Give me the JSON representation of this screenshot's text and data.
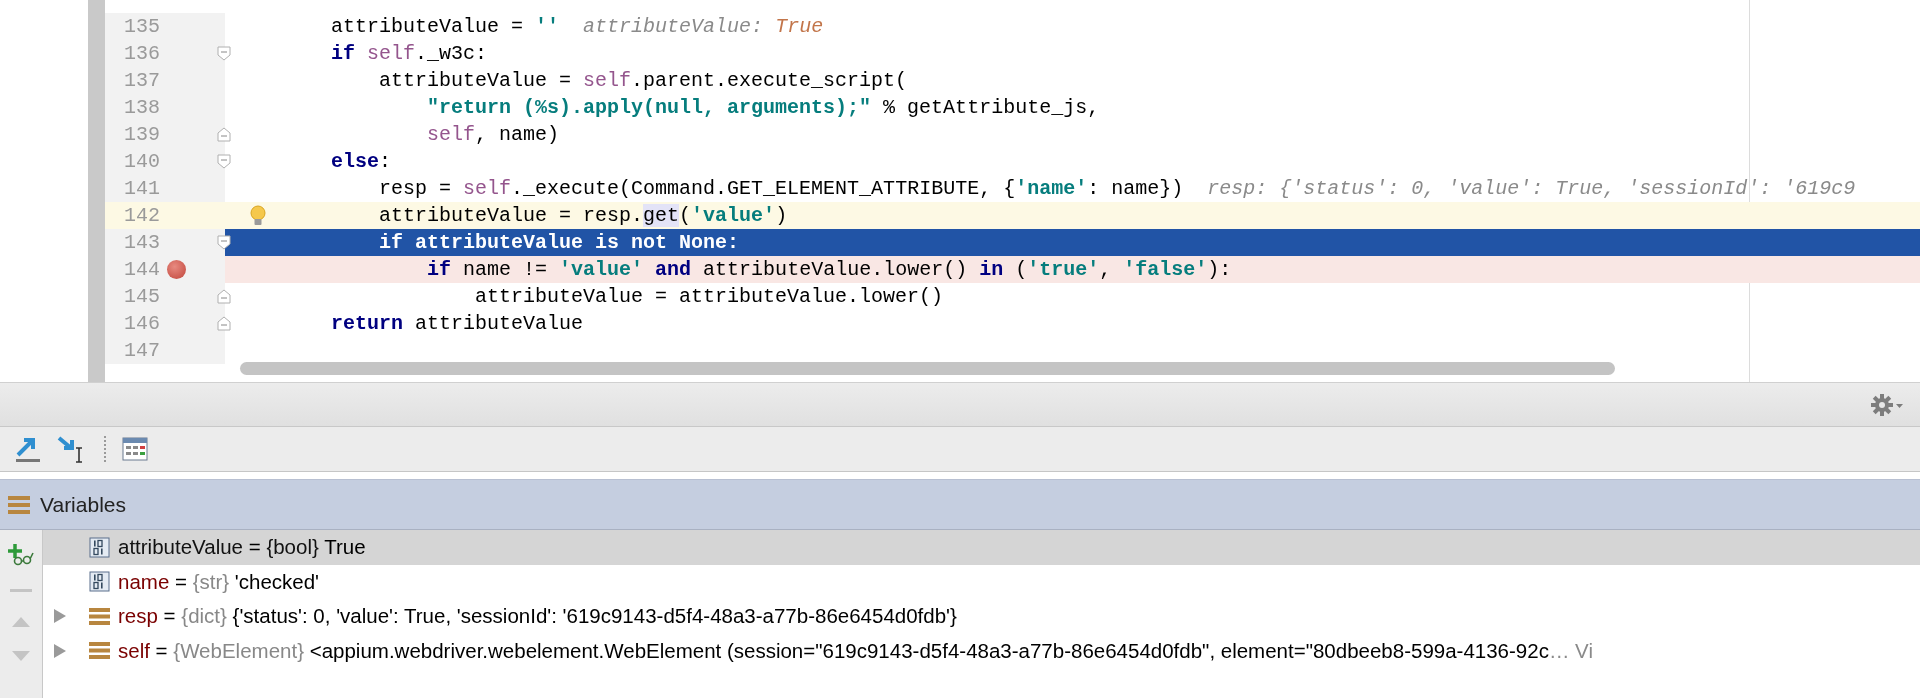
{
  "editor": {
    "lines": [
      {
        "number": "135",
        "caret_line": false,
        "execution_point": false,
        "breakpoint": false,
        "bulb": false,
        "fold_open": false,
        "fold_close": false,
        "tokens": [
          {
            "kind": "plain",
            "text": "        attributeValue = "
          },
          {
            "kind": "string",
            "text": "''"
          },
          {
            "kind": "hint",
            "text": "  attributeValue: "
          },
          {
            "kind": "hint_value",
            "text": "True"
          }
        ]
      },
      {
        "number": "136",
        "caret_line": false,
        "execution_point": false,
        "breakpoint": false,
        "bulb": false,
        "fold_open": true,
        "fold_close": false,
        "tokens": [
          {
            "kind": "keyword",
            "text": "        if "
          },
          {
            "kind": "self",
            "text": "self"
          },
          {
            "kind": "plain",
            "text": "._w3c:"
          }
        ]
      },
      {
        "number": "137",
        "caret_line": false,
        "execution_point": false,
        "breakpoint": false,
        "bulb": false,
        "fold_open": false,
        "fold_close": false,
        "tokens": [
          {
            "kind": "plain",
            "text": "            attributeValue = "
          },
          {
            "kind": "self",
            "text": "self"
          },
          {
            "kind": "plain",
            "text": ".parent.execute_script("
          }
        ]
      },
      {
        "number": "138",
        "caret_line": false,
        "execution_point": false,
        "breakpoint": false,
        "bulb": false,
        "fold_open": false,
        "fold_close": false,
        "tokens": [
          {
            "kind": "string",
            "text": "                \"return (%s).apply(null, arguments);\""
          },
          {
            "kind": "plain",
            "text": " % getAttribute_js,"
          }
        ]
      },
      {
        "number": "139",
        "caret_line": false,
        "execution_point": false,
        "breakpoint": false,
        "bulb": false,
        "fold_open": false,
        "fold_close": true,
        "tokens": [
          {
            "kind": "self",
            "text": "                self"
          },
          {
            "kind": "plain",
            "text": ", name)"
          }
        ]
      },
      {
        "number": "140",
        "caret_line": false,
        "execution_point": false,
        "breakpoint": false,
        "bulb": false,
        "fold_open": true,
        "fold_close": false,
        "tokens": [
          {
            "kind": "keyword",
            "text": "        else"
          },
          {
            "kind": "plain",
            "text": ":"
          }
        ]
      },
      {
        "number": "141",
        "caret_line": false,
        "execution_point": false,
        "breakpoint": false,
        "bulb": false,
        "fold_open": false,
        "fold_close": false,
        "tokens": [
          {
            "kind": "plain",
            "text": "            resp = "
          },
          {
            "kind": "self",
            "text": "self"
          },
          {
            "kind": "plain",
            "text": "._execute(Command.GET_ELEMENT_ATTRIBUTE, {"
          },
          {
            "kind": "string",
            "text": "'name'"
          },
          {
            "kind": "plain",
            "text": ": name})"
          },
          {
            "kind": "hint",
            "text": "  resp: {'status': 0, 'value': True, 'sessionId': '619c9"
          }
        ]
      },
      {
        "number": "142",
        "caret_line": true,
        "execution_point": false,
        "breakpoint": false,
        "bulb": true,
        "fold_open": false,
        "fold_close": false,
        "tokens": [
          {
            "kind": "plain",
            "text": "            attributeValue = resp."
          },
          {
            "kind": "usage",
            "text": "get"
          },
          {
            "kind": "plain",
            "text": "("
          },
          {
            "kind": "string",
            "text": "'value'"
          },
          {
            "kind": "plain",
            "text": ")"
          }
        ]
      },
      {
        "number": "143",
        "caret_line": false,
        "execution_point": true,
        "breakpoint": false,
        "bulb": false,
        "fold_open": true,
        "fold_close": false,
        "tokens": [
          {
            "kind": "keyword",
            "text": "            if"
          },
          {
            "kind": "plain",
            "text": " attributeValue "
          },
          {
            "kind": "keyword",
            "text": "is not None"
          },
          {
            "kind": "plain",
            "text": ":"
          }
        ]
      },
      {
        "number": "144",
        "caret_line": false,
        "execution_point": false,
        "breakpoint": true,
        "bulb": false,
        "fold_open": false,
        "fold_close": false,
        "tokens": [
          {
            "kind": "keyword",
            "text": "                if"
          },
          {
            "kind": "plain",
            "text": " name != "
          },
          {
            "kind": "string",
            "text": "'value'"
          },
          {
            "kind": "keyword",
            "text": " and"
          },
          {
            "kind": "plain",
            "text": " attributeValue.lower() "
          },
          {
            "kind": "keyword",
            "text": "in"
          },
          {
            "kind": "plain",
            "text": " ("
          },
          {
            "kind": "string",
            "text": "'true'"
          },
          {
            "kind": "plain",
            "text": ", "
          },
          {
            "kind": "string",
            "text": "'false'"
          },
          {
            "kind": "plain",
            "text": "):"
          }
        ]
      },
      {
        "number": "145",
        "caret_line": false,
        "execution_point": false,
        "breakpoint": false,
        "bulb": false,
        "fold_open": false,
        "fold_close": true,
        "tokens": [
          {
            "kind": "plain",
            "text": "                    attributeValue = attributeValue.lower()"
          }
        ]
      },
      {
        "number": "146",
        "caret_line": false,
        "execution_point": false,
        "breakpoint": false,
        "bulb": false,
        "fold_open": false,
        "fold_close": true,
        "tokens": [
          {
            "kind": "keyword",
            "text": "        return"
          },
          {
            "kind": "plain",
            "text": " attributeValue"
          }
        ]
      },
      {
        "number": "147",
        "caret_line": false,
        "execution_point": false,
        "breakpoint": false,
        "bulb": false,
        "fold_open": false,
        "fold_close": false
      }
    ]
  },
  "variables": {
    "title": "Variables",
    "rows": [
      {
        "kind": "primitive",
        "expandable": false,
        "selected": true,
        "name": "attributeValue",
        "operator": "=",
        "type": "{bool}",
        "value": "True"
      },
      {
        "kind": "primitive",
        "expandable": false,
        "selected": false,
        "name": "name",
        "operator": "=",
        "type": "{str}",
        "value": "'checked'"
      },
      {
        "kind": "object",
        "expandable": true,
        "selected": false,
        "name": "resp",
        "operator": "=",
        "type": "{dict}",
        "value": "{'status': 0, 'value': True, 'sessionId': '619c9143-d5f4-48a3-a77b-86e6454d0fdb'}"
      },
      {
        "kind": "object",
        "expandable": true,
        "selected": false,
        "name": "self",
        "operator": "=",
        "type": "{WebElement}",
        "value": "<appium.webdriver.webelement.WebElement (session=\"619c9143-d5f4-48a3-a77b-86e6454d0fdb\", element=\"80dbeeb8-599a-4136-92c",
        "more": "… Vi"
      }
    ]
  }
}
